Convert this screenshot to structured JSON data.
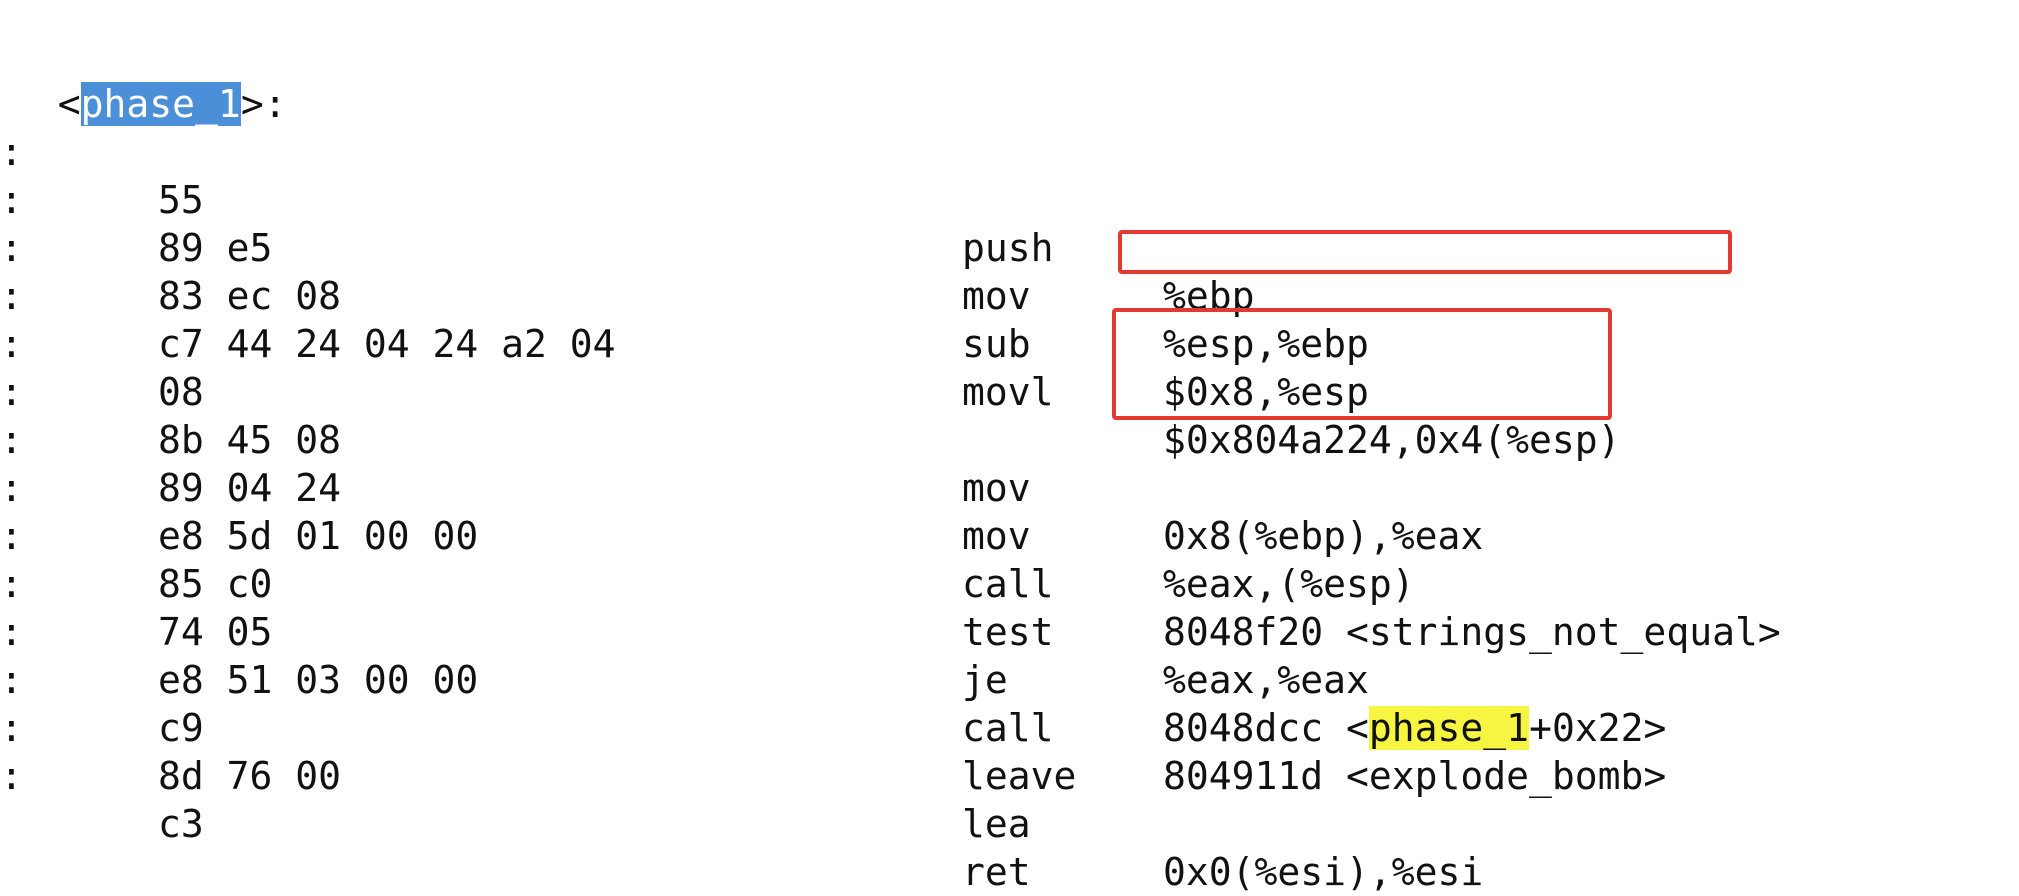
{
  "header": {
    "open": "<",
    "symbol": "phase_1",
    "close": ">:"
  },
  "rows": [
    {
      "colon": ":",
      "bytes": "55",
      "mnemonic": "push",
      "operands": "%ebp"
    },
    {
      "colon": ":",
      "bytes": "89 e5",
      "mnemonic": "mov",
      "operands": "%esp,%ebp"
    },
    {
      "colon": ":",
      "bytes": "83 ec 08",
      "mnemonic": "sub",
      "operands": "$0x8,%esp"
    },
    {
      "colon": ":",
      "bytes": "c7 44 24 04 24 a2 04",
      "mnemonic": "movl",
      "operands": "$0x804a224,0x4(%esp)"
    },
    {
      "colon": ":",
      "bytes": "08",
      "mnemonic": "",
      "operands": ""
    },
    {
      "colon": ":",
      "bytes": "8b 45 08",
      "mnemonic": "mov",
      "operands": "0x8(%ebp),%eax"
    },
    {
      "colon": ":",
      "bytes": "89 04 24",
      "mnemonic": "mov",
      "operands": "%eax,(%esp)"
    },
    {
      "colon": ":",
      "bytes": "e8 5d 01 00 00",
      "mnemonic": "call",
      "operands": "8048f20 <strings_not_equal>"
    },
    {
      "colon": ":",
      "bytes": "85 c0",
      "mnemonic": "test",
      "operands": "%eax,%eax"
    },
    {
      "colon": ":",
      "bytes": "74 05",
      "mnemonic": "je",
      "operands_pre": "8048dcc <",
      "operands_hl": "phase_1",
      "operands_post": "+0x22>"
    },
    {
      "colon": ":",
      "bytes": "e8 51 03 00 00",
      "mnemonic": "call",
      "operands": "804911d <explode_bomb>"
    },
    {
      "colon": ":",
      "bytes": "c9",
      "mnemonic": "leave",
      "operands": ""
    },
    {
      "colon": ":",
      "bytes": "8d 76 00",
      "mnemonic": "lea",
      "operands": "0x0(%esi),%esi"
    },
    {
      "colon": ":",
      "bytes": "c3",
      "mnemonic": "ret",
      "operands": ""
    }
  ],
  "colors": {
    "selection": "#4a8fd8",
    "search_highlight": "#f6f542",
    "annotation_box": "#e23a30"
  }
}
